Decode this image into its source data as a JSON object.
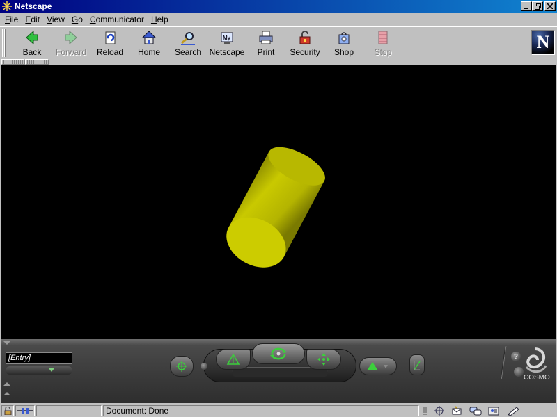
{
  "window": {
    "title": "Netscape"
  },
  "menu": [
    "File",
    "Edit",
    "View",
    "Go",
    "Communicator",
    "Help"
  ],
  "toolbar": {
    "buttons": [
      {
        "label": "Back",
        "icon": "back-arrow-icon",
        "enabled": true
      },
      {
        "label": "Forward",
        "icon": "forward-arrow-icon",
        "enabled": false
      },
      {
        "label": "Reload",
        "icon": "reload-icon",
        "enabled": true
      },
      {
        "label": "Home",
        "icon": "home-icon",
        "enabled": true
      },
      {
        "label": "Search",
        "icon": "search-icon",
        "enabled": true
      },
      {
        "label": "Netscape",
        "icon": "my-netscape-icon",
        "enabled": true
      },
      {
        "label": "Print",
        "icon": "printer-icon",
        "enabled": true
      },
      {
        "label": "Security",
        "icon": "padlock-icon",
        "enabled": true
      },
      {
        "label": "Shop",
        "icon": "shopping-bag-icon",
        "enabled": true
      },
      {
        "label": "Stop",
        "icon": "stop-icon",
        "enabled": false
      }
    ],
    "logo_letter": "N"
  },
  "viewport": {
    "background": "#000000",
    "object": "yellow-cylinder",
    "object_color": "#cccc00"
  },
  "cosmo": {
    "viewpoint_entry": "[Entry]",
    "brand": "COSMO",
    "help_glyph": "?"
  },
  "status": {
    "text": "Document: Done"
  },
  "colors": {
    "titlebar": "#000080",
    "chrome": "#c0c0c0",
    "accent_green": "#3ccf3c"
  }
}
